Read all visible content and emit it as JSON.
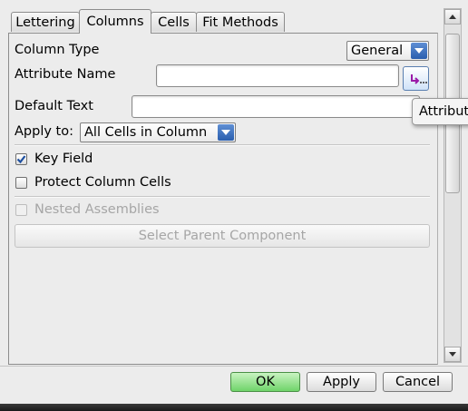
{
  "tabs": [
    "Lettering",
    "Columns",
    "Cells",
    "Fit Methods"
  ],
  "active_tab": "Columns",
  "column_type": {
    "label": "Column Type",
    "value": "General"
  },
  "attribute_name": {
    "label": "Attribute Name",
    "value": ""
  },
  "default_text": {
    "label": "Default Text",
    "value": ""
  },
  "apply_to": {
    "label": "Apply to:",
    "value": "All Cells in Column"
  },
  "key_field": {
    "label": "Key Field",
    "checked": true
  },
  "protect_column_cells": {
    "label": "Protect Column Cells",
    "checked": false
  },
  "nested_assemblies": {
    "label": "Nested Assemblies",
    "checked": false,
    "enabled": false
  },
  "select_parent_component": {
    "label": "Select Parent Component",
    "enabled": false
  },
  "tooltip": {
    "text": "Attribut"
  },
  "buttons": {
    "ok": "OK",
    "apply": "Apply",
    "cancel": "Cancel"
  },
  "colors": {
    "accent": "#2a5eae",
    "ok_button": "#6fd46a",
    "disabled_text": "#a6a6a6"
  }
}
